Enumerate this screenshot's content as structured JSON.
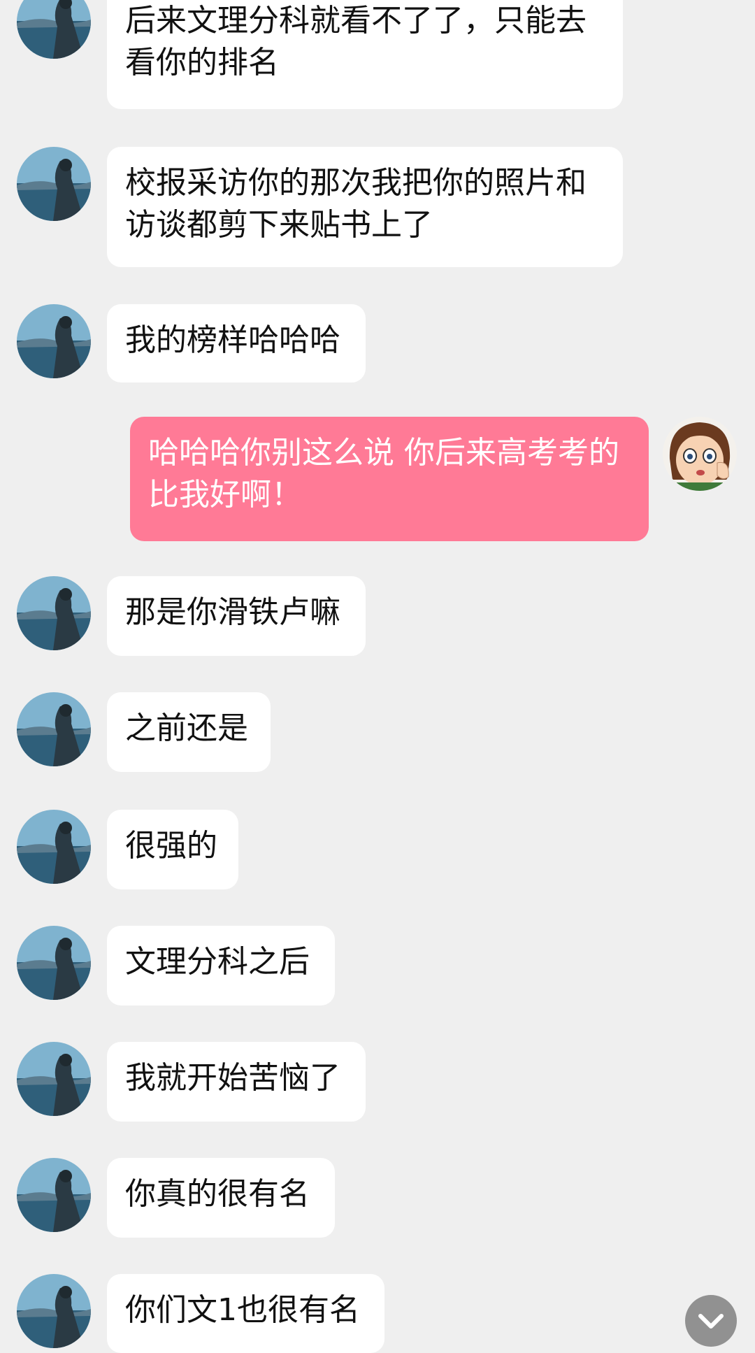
{
  "colors": {
    "background": "#efefef",
    "incoming_bubble": "#ffffff",
    "outgoing_bubble": "#ff7a96",
    "incoming_text": "#111111",
    "outgoing_text": "#ffffff",
    "scroll_button": "#808080"
  },
  "messages": [
    {
      "sender": "other",
      "text": "后来文理分科就看不了了，只能去看你的排名"
    },
    {
      "sender": "other",
      "text": "校报采访你的那次我把你的照片和访谈都剪下来贴书上了"
    },
    {
      "sender": "other",
      "text": "我的榜样哈哈哈"
    },
    {
      "sender": "me",
      "text": "哈哈哈你别这么说 你后来高考考的比我好啊！"
    },
    {
      "sender": "other",
      "text": "那是你滑铁卢嘛"
    },
    {
      "sender": "other",
      "text": "之前还是"
    },
    {
      "sender": "other",
      "text": "很强的"
    },
    {
      "sender": "other",
      "text": "文理分科之后"
    },
    {
      "sender": "other",
      "text": "我就开始苦恼了"
    },
    {
      "sender": "other",
      "text": "你真的很有名"
    },
    {
      "sender": "other",
      "text": "你们文1也很有名"
    }
  ],
  "icons": {
    "other_avatar": "seaside-photo-avatar",
    "my_avatar": "anime-girl-avatar",
    "scroll_button": "chevron-down-icon"
  }
}
